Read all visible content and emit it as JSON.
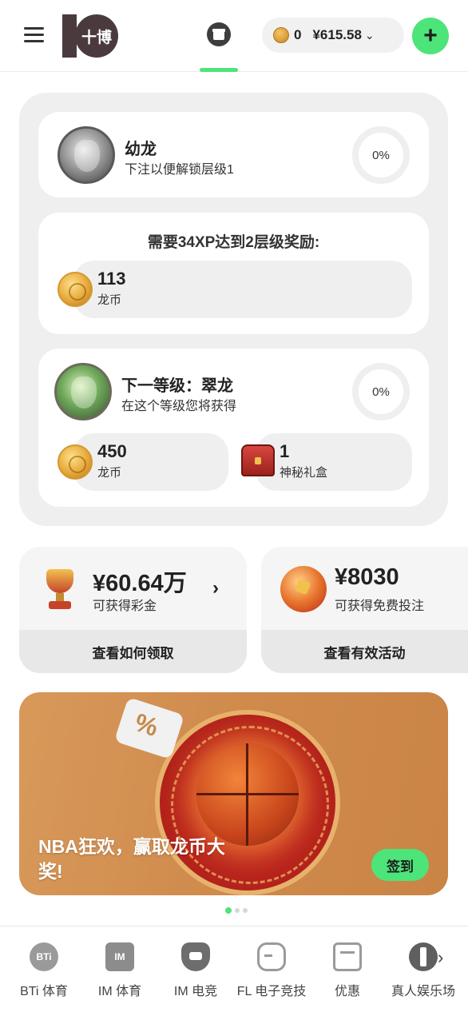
{
  "header": {
    "logo_text": "十博",
    "dragon_coin_count": "0",
    "balance": "¥615.58",
    "icons": {
      "menu": "hamburger-icon",
      "gift": "gift-icon",
      "coin": "dragon-coin-icon",
      "chevron": "chevron-down-icon",
      "plus": "plus-icon"
    },
    "accent_color": "#4de47a"
  },
  "current_level": {
    "title": "幼龙",
    "subtitle": "下注以便解锁层级1",
    "progress": "0%"
  },
  "requirement": {
    "text": "需要34XP达到2层级奖励:",
    "reward_amount": "113",
    "reward_label": "龙币"
  },
  "next_level": {
    "title": "下一等级：翠龙",
    "subtitle": "在这个等级您将获得",
    "progress": "0%",
    "rewards": [
      {
        "amount": "450",
        "label": "龙币",
        "icon": "dragon-coin-icon"
      },
      {
        "amount": "1",
        "label": "神秘礼盒",
        "icon": "mystery-chest-icon"
      }
    ]
  },
  "promos": [
    {
      "amount": "¥60.64万",
      "label": "可获得彩金",
      "button": "查看如何领取",
      "icon": "trophy-icon"
    },
    {
      "amount": "¥8030",
      "label": "可获得免费投注",
      "button": "查看有效活动",
      "icon": "soccer-ball-icon"
    }
  ],
  "banner": {
    "text": "NBA狂欢，赢取龙币大奖!",
    "button": "签到",
    "slides": 3,
    "active_slide": 1
  },
  "bottom_nav": [
    {
      "label": "BTi 体育",
      "icon": "bti-sports-icon",
      "icon_text": "BTi"
    },
    {
      "label": "IM 体育",
      "icon": "im-sports-icon",
      "icon_text": "IM"
    },
    {
      "label": "IM 电竞",
      "icon": "bull-esports-icon"
    },
    {
      "label": "FL 电子竞技",
      "icon": "gamepad-icon"
    },
    {
      "label": "优惠",
      "icon": "promotions-icon"
    },
    {
      "label": "真人娱乐场",
      "icon": "live-casino-icon"
    }
  ]
}
